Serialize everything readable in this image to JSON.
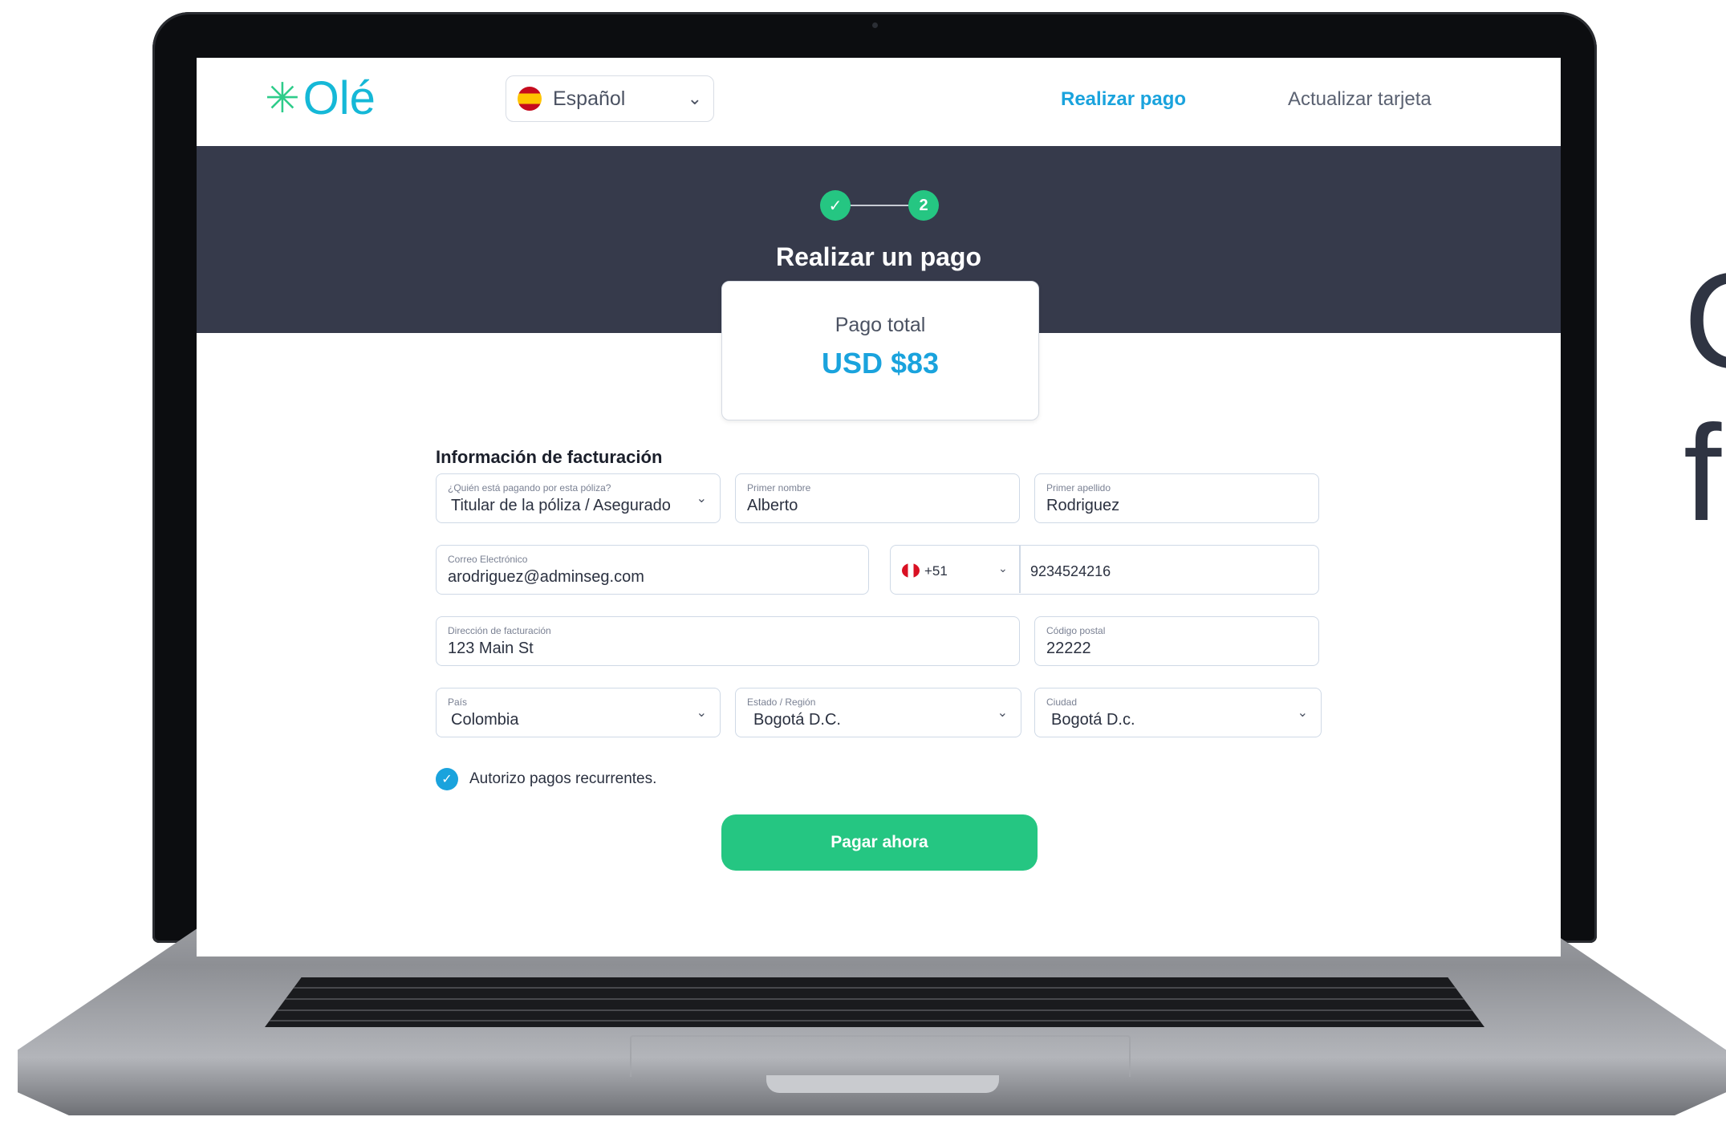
{
  "header": {
    "logo_mark": "✳",
    "logo_text": "Olé",
    "language": "Español",
    "language_flag_icon": "spain-flag-icon",
    "nav": {
      "pay_label": "Realizar pago",
      "update_card_label": "Actualizar tarjeta"
    }
  },
  "stepper": {
    "step1_symbol": "✓",
    "step2_label": "2"
  },
  "page_title": "Realizar un pago",
  "total": {
    "label": "Pago total",
    "amount": "USD $83"
  },
  "form": {
    "title": "Información de facturación",
    "payer": {
      "label": "¿Quién está pagando por esta póliza?",
      "value": "Titular de la póliza / Asegurado"
    },
    "first_name": {
      "label": "Primer nombre",
      "value": "Alberto"
    },
    "last_name": {
      "label": "Primer apellido",
      "value": "Rodriguez"
    },
    "email": {
      "label": "Correo Electrónico",
      "value": "arodriguez@adminseg.com"
    },
    "phone": {
      "country_code": "+51",
      "country_flag_icon": "peru-flag-icon",
      "number": "9234524216"
    },
    "address": {
      "label": "Dirección de facturación",
      "value": "123 Main St"
    },
    "postal_code": {
      "label": "Código postal",
      "value": "22222"
    },
    "country": {
      "label": "País",
      "value": "Colombia"
    },
    "state": {
      "label": "Estado / Región",
      "value": "Bogotá D.C."
    },
    "city": {
      "label": "Ciudad",
      "value": "Bogotá D.c."
    },
    "recurring": {
      "label": "Autorizo pagos recurrentes.",
      "checked": true
    },
    "submit_label": "Pagar ahora"
  },
  "side_text": {
    "line1": "C",
    "line2": "f"
  },
  "colors": {
    "accent_blue": "#1aa3dd",
    "accent_green": "#25c682",
    "band_dark": "#363a4b"
  }
}
